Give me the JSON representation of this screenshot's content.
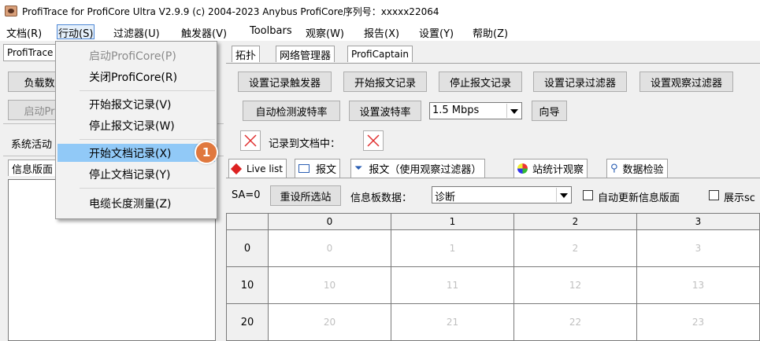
{
  "window": {
    "title": "ProfiTrace for ProfiCore Ultra V2.9.9 (c) 2004-2023 Anybus  ProfiCore序列号：xxxxx22064"
  },
  "menubar": [
    "文档(R)",
    "行动(S)",
    "过滤器(U)",
    "触发器(V)",
    "Toolbars",
    "观察(W)",
    "报告(X)",
    "设置(Y)",
    "帮助(Z)"
  ],
  "left": {
    "tab": "ProfiTrace",
    "load_button": "负载数",
    "start_button": "启动Pr",
    "system_label": "系统活动",
    "info_label": "信息版面"
  },
  "tabs": [
    "拓扑",
    "网络管理器",
    "ProfiCaptain"
  ],
  "toolbar1": [
    "设置记录触发器",
    "开始报文记录",
    "停止报文记录",
    "设置记录过滤器",
    "设置观察过滤器"
  ],
  "toolbar2": {
    "autodetect": "自动检测波特率",
    "set_baud": "设置波特率",
    "baud_value": "1.5 Mbps",
    "wizard": "向导"
  },
  "record": {
    "label": "记录到文档中："
  },
  "view_tabs": [
    "Live list",
    "报文",
    "报文（使用观察过滤器）",
    "站统计观察",
    "数据检验"
  ],
  "station_row": {
    "sa_text": "SA=0",
    "reset_button": "重设所选站",
    "info_board_label": "信息板数据：",
    "info_board_value": "诊断",
    "auto_update": "自动更新信息版面",
    "show_label": "展示sc"
  },
  "grid": {
    "columns": [
      "0",
      "1",
      "2",
      "3"
    ],
    "rows": [
      {
        "label": "0",
        "cells": [
          "0",
          "1",
          "2",
          "3"
        ]
      },
      {
        "label": "10",
        "cells": [
          "10",
          "11",
          "12",
          "13"
        ]
      },
      {
        "label": "20",
        "cells": [
          "20",
          "21",
          "22",
          "23"
        ]
      }
    ]
  },
  "dropdown": {
    "items": [
      "启动ProfiCore(P)",
      "关闭ProfiCore(R)",
      "开始报文记录(V)",
      "停止报文记录(W)",
      "开始文档记录(X)",
      "停止文档记录(Y)",
      "电缆长度测量(Z)"
    ],
    "highlighted": "开始文档记录(X)",
    "disabled": "启动ProfiCore(P)"
  },
  "callout": {
    "number": "1",
    "color": "#e0783e"
  },
  "colors": {
    "highlight": "#91c9f7",
    "menu_active_border": "#4f88d6",
    "x_red": "#e03030"
  }
}
